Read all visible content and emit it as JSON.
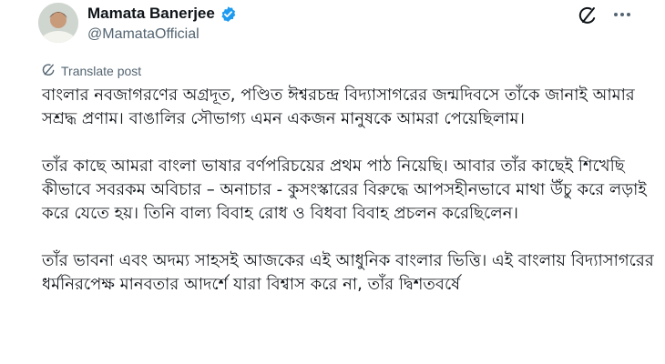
{
  "post": {
    "author": {
      "display_name": "Mamata Banerjee",
      "handle": "@MamataOfficial",
      "verified": true
    },
    "translate_label": "Translate post",
    "paragraphs": [
      "বাংলার নবজাগরণের অগ্রদূত, পণ্ডিত ঈশ্বরচন্দ্র বিদ্যাসাগরের জন্মদিবসে তাঁকে জানাই আমার সশ্রদ্ধ প্রণাম। বাঙালির সৌভাগ্য এমন একজন মানুষকে আমরা পেয়েছিলাম।",
      "তাঁর কাছে আমরা বাংলা ভাষার বর্ণপরিচয়ের প্রথম পাঠ নিয়েছি। আবার তাঁর কাছেই শিখেছি কীভাবে সবরকম অবিচার – অনাচার - কুসংস্কারের বিরুদ্ধে আপসহীনভাবে মাথা উঁচু করে লড়াই করে যেতে হয়। তিনি বাল্য বিবাহ রোধ ও বিধবা বিবাহ প্রচলন করেছিলেন।",
      "তাঁর ভাবনা এবং অদম্য সাহসই আজকের এই আধুনিক বাংলার ভিত্তি। এই বাংলায় বিদ্যাসাগরের ধর্মনিরপেক্ষ মানবতার আদর্শে যারা বিশ্বাস করে না, তাঁর দ্বিশতবর্ষে"
    ]
  },
  "colors": {
    "verified_badge": "#1d9bf0",
    "secondary_text": "#536471",
    "primary_text": "#0f1419"
  },
  "icons": {
    "grok": "grok-icon",
    "more": "more-icon",
    "translate": "translate-icon",
    "verified": "verified-badge-icon"
  }
}
